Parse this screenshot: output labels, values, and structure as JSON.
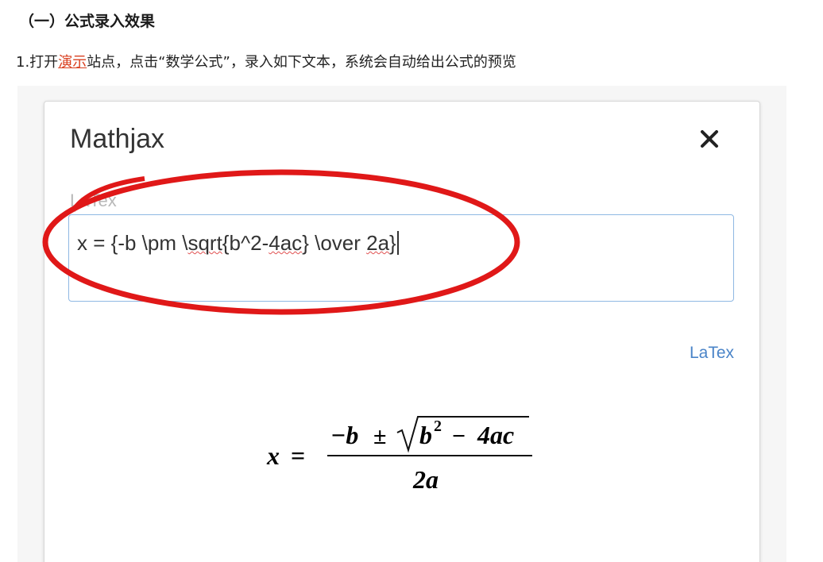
{
  "section_heading": "（一）公式录入效果",
  "step": {
    "prefix": "1.打开",
    "link": "演示",
    "suffix": "站点，点击“数学公式”，录入如下文本，系统会自动给出公式的预览"
  },
  "modal": {
    "title": "Mathjax",
    "close_label": "✕",
    "field_label": "LaTex",
    "input_parts": {
      "a": "x = {-b \\pm \\",
      "b": "sqrt",
      "c": "{b^2-",
      "d": "4ac",
      "e": "} \\over ",
      "f": "2a",
      "g": "}"
    },
    "mode_link": "LaTex",
    "formula": {
      "lhs": "x",
      "equals": "=",
      "numerator_minus_b": "−b",
      "pm": "±",
      "b": "b",
      "exp": "2",
      "minus": "−",
      "four_ac": "4ac",
      "denominator": "2a"
    }
  },
  "colors": {
    "link": "#d93f1f",
    "annotation": "#e01818",
    "mode_link": "#4a84c8",
    "input_border": "#8fb8e3"
  }
}
